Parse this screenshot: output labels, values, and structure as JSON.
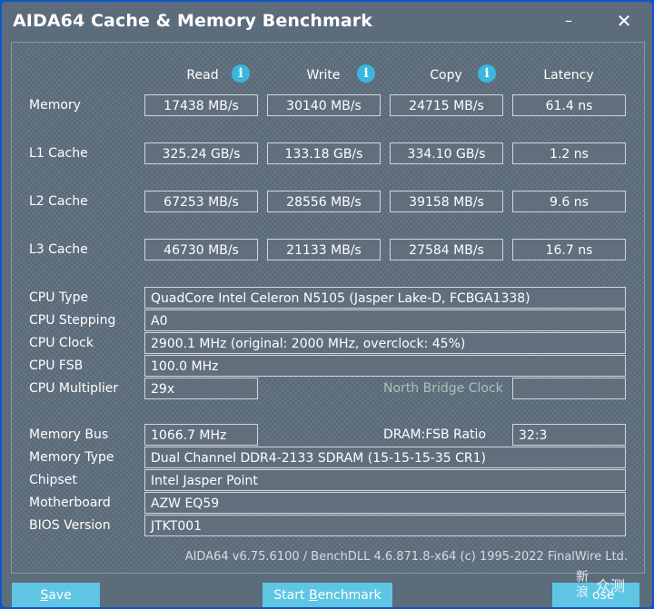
{
  "window": {
    "title": "AIDA64 Cache & Memory Benchmark",
    "minimize_glyph": "–",
    "close_glyph": "✕"
  },
  "headers": {
    "read": "Read",
    "write": "Write",
    "copy": "Copy",
    "latency": "Latency",
    "info_glyph": "i"
  },
  "rows": {
    "memory": {
      "label": "Memory",
      "read": "17438 MB/s",
      "write": "30140 MB/s",
      "copy": "24715 MB/s",
      "latency": "61.4 ns"
    },
    "l1": {
      "label": "L1 Cache",
      "read": "325.24 GB/s",
      "write": "133.18 GB/s",
      "copy": "334.10 GB/s",
      "latency": "1.2 ns"
    },
    "l2": {
      "label": "L2 Cache",
      "read": "67253 MB/s",
      "write": "28556 MB/s",
      "copy": "39158 MB/s",
      "latency": "9.6 ns"
    },
    "l3": {
      "label": "L3 Cache",
      "read": "46730 MB/s",
      "write": "21133 MB/s",
      "copy": "27584 MB/s",
      "latency": "16.7 ns"
    }
  },
  "cpu": {
    "type_label": "CPU Type",
    "type": "QuadCore Intel Celeron N5105  (Jasper Lake-D, FCBGA1338)",
    "stepping_label": "CPU Stepping",
    "stepping": "A0",
    "clock_label": "CPU Clock",
    "clock": "2900.1 MHz  (original: 2000 MHz, overclock: 45%)",
    "fsb_label": "CPU FSB",
    "fsb": "100.0 MHz",
    "multiplier_label": "CPU Multiplier",
    "multiplier": "29x",
    "nb_clock_label": "North Bridge Clock",
    "nb_clock": ""
  },
  "memory_info": {
    "bus_label": "Memory Bus",
    "bus": "1066.7 MHz",
    "ratio_label": "DRAM:FSB Ratio",
    "ratio": "32:3",
    "type_label": "Memory Type",
    "type": "Dual Channel DDR4-2133 SDRAM  (15-15-15-35 CR1)",
    "chipset_label": "Chipset",
    "chipset": "Intel Jasper Point",
    "motherboard_label": "Motherboard",
    "motherboard": "AZW EQ59",
    "bios_label": "BIOS Version",
    "bios": "JTKT001"
  },
  "footer": "AIDA64 v6.75.6100 / BenchDLL 4.6.871.8-x64  (c) 1995-2022 FinalWire Ltd.",
  "buttons": {
    "save_first": "S",
    "save_rest": "ave",
    "start_first": "Start ",
    "start_u": "B",
    "start_rest": "enchmark",
    "close_visible": "ose"
  },
  "watermark": {
    "line1": "新",
    "line2": "浪",
    "line3": "众测"
  }
}
